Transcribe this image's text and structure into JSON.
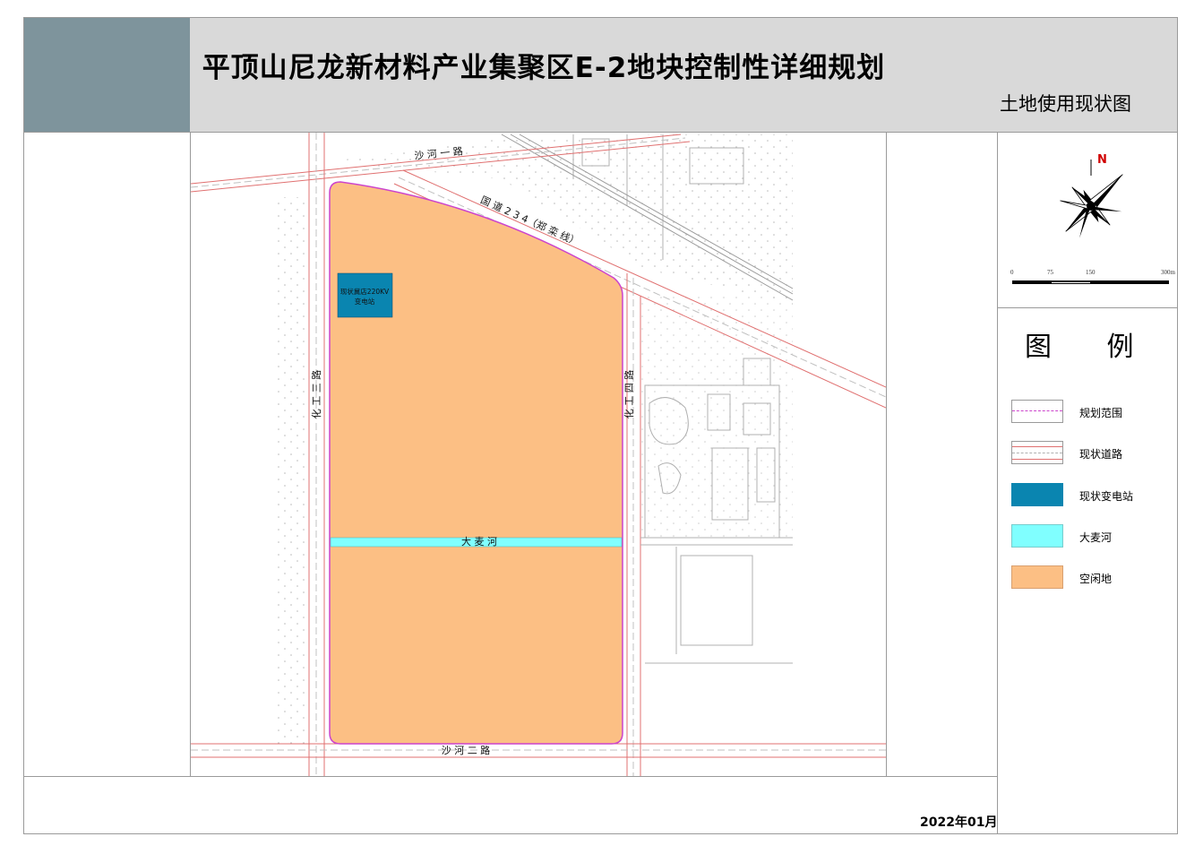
{
  "header": {
    "title": "平顶山尼龙新材料产业集聚区E-2地块控制性详细规划",
    "subtitle": "土地使用现状图"
  },
  "compass": {
    "north_label": "N"
  },
  "scale_bar": {
    "labels": [
      "0",
      "75",
      "150",
      "300m"
    ]
  },
  "legend": {
    "title": "图  例",
    "items": [
      {
        "label": "规划范围",
        "color": "#cc44cc"
      },
      {
        "label": "现状道路",
        "color": "#e07070"
      },
      {
        "label": "现状变电站",
        "color": "#0a85b0"
      },
      {
        "label": "大麦河",
        "color": "#80ffff"
      },
      {
        "label": "空闲地",
        "color": "#fcbf84"
      }
    ]
  },
  "map": {
    "road_north": "沙 河 一 路",
    "road_diagonal": "国 道 2 3 4（郑 栾 线）",
    "road_west": "化 工 三 路",
    "road_east": "化 工 四 路",
    "road_south": "沙 河 二 路",
    "river": "大 麦 河",
    "substation_line1": "现状冀店220KV",
    "substation_line2": "变电站"
  },
  "footer": {
    "date": "2022年01月"
  }
}
